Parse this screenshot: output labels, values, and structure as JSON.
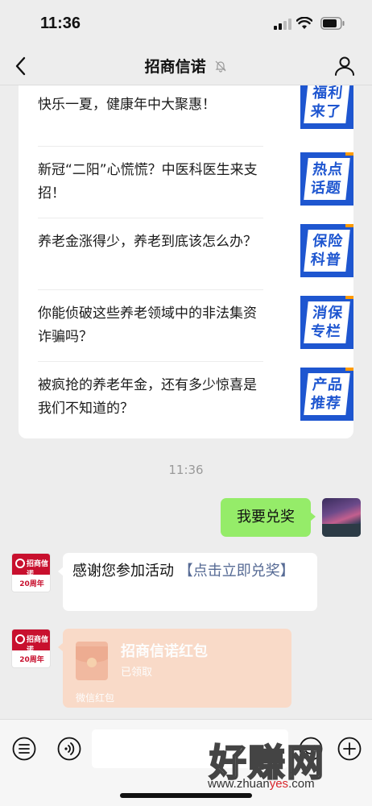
{
  "status_bar": {
    "time": "11:36"
  },
  "nav": {
    "title": "招商信诺"
  },
  "articles": [
    {
      "title": "快乐一夏，健康年中大聚惠！",
      "thumb_line1": "福利",
      "thumb_line2": "来了"
    },
    {
      "title": "新冠“二阳”心慌慌？中医科医生来支招！",
      "thumb_line1": "热点",
      "thumb_line2": "话题"
    },
    {
      "title": "养老金涨得少，养老到底该怎么办？",
      "thumb_line1": "保险",
      "thumb_line2": "科普"
    },
    {
      "title": "你能侦破这些养老领域中的非法集资诈骗吗？",
      "thumb_line1": "消保",
      "thumb_line2": "专栏"
    },
    {
      "title": "被疯抢的养老年金，还有多少惊喜是我们不知道的？",
      "thumb_line1": "产品",
      "thumb_line2": "推荐"
    }
  ],
  "chat": {
    "timestamp": "11:36",
    "outgoing_message": "我要兑奖",
    "incoming_message_prefix": "感谢您参加活动",
    "incoming_message_link": "【点击立即兑奖】",
    "brand_avatar_name": "招商信诺",
    "brand_avatar_year": "20周年",
    "red_packet": {
      "title": "招商信诺红包",
      "status": "已领取",
      "footer": "微信红包"
    }
  },
  "watermark": {
    "text": "好赚网",
    "url_prefix": "www.zhuan",
    "url_highlight": "yes",
    "url_suffix": ".com"
  },
  "colors": {
    "accent_green": "#95ec69",
    "link_blue": "#576b95",
    "brand_red": "#c8102e",
    "thumb_blue": "#1e56d0"
  }
}
